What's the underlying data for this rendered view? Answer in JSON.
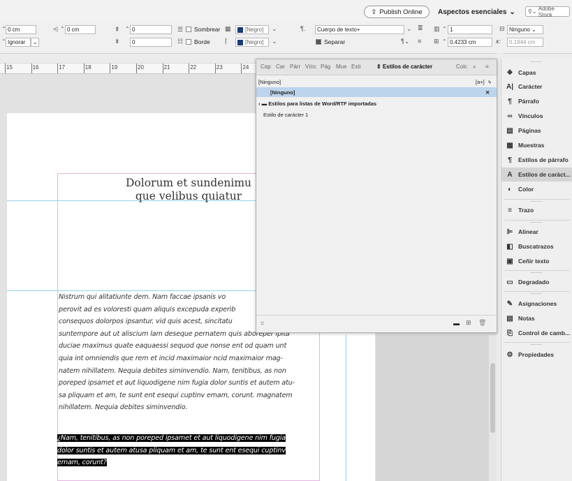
{
  "topbar": {
    "publish_label": "Publish Online",
    "workspace_label": "Aspectos esenciales",
    "stock_placeholder": "Adobe Stock"
  },
  "control": {
    "indent_left": "0 cm",
    "indent_first": "0 cm",
    "space_before": "0",
    "space_after": "0",
    "align_value": "Ignorar",
    "shading_label": "Sombrear",
    "border_label": "Borde",
    "shading_color": "[Negro]",
    "border_color": "[Negro]",
    "para_style": "Cuerpo de texto+",
    "separate_label": "Separar",
    "columns": "1",
    "gutter": "0.4233 cm",
    "none_label": "Ninguno",
    "x_label": "x:",
    "x_value": "0.1944 cm"
  },
  "ruler": {
    "ticks": [
      "15",
      "16",
      "17",
      "18",
      "19",
      "20",
      "21",
      "22",
      "23",
      "24"
    ]
  },
  "document": {
    "headline_line1": "Dolorum et sundenimu",
    "headline_line2": "que velibus quiatur",
    "body_lines": [
      "Nistrum qui alitatiunte dem. Nam faccae ipsanis vo",
      "perovit ad es voloresti quam aliquis excepuda experib",
      "consequos dolorpos ipsantur, vid quis acest, sincitatu",
      "suntempore aut ut aliscium lam deseque pernatem quis aboreper ipita",
      "duciae maximus quate eaquaessi sequod que nonse ent od quam unt",
      "quia int omniendis que rem et incid maximaior ncid maximaior mag-",
      "natem nihillatem. Nequia debites siminvendio. Nam, tenitibus, as non",
      "poreped ipsamet et aut liquodigene nim fugia dolor suntis et autem atu-",
      "sa pliquam et am, te sunt ent esequi cuptinv emam, corunt. magnatem",
      "nihillatem. Nequia debites siminvendio."
    ],
    "selected_lines": [
      "¿Nam, tenitibus, as non poreped ipsamet et aut liquodigene nim fugia",
      "dolor suntis et autem atusa pliquam et am, te sunt ent esequi cuptinv",
      "emam, corunt?"
    ]
  },
  "char_panel": {
    "tabs": [
      "Cap",
      "Car",
      "Párr",
      "Vínc",
      "Pág",
      "Mue",
      "Esti"
    ],
    "active_tab": "Estilos de carácter",
    "extra_tab": "Colc",
    "current_style": "[Ninguno]",
    "items": [
      "[Ninguno]",
      "Estilos para listas de Word/RTF importadas",
      "Estilo de carácter 1"
    ]
  },
  "dock": {
    "items": [
      {
        "label": "Capas",
        "icon": "layers-icon"
      },
      {
        "label": "Carácter",
        "icon": "character-icon"
      },
      {
        "label": "Párrafo",
        "icon": "paragraph-icon"
      },
      {
        "label": "Vínculos",
        "icon": "links-icon"
      },
      {
        "label": "Páginas",
        "icon": "pages-icon"
      },
      {
        "label": "Muestras",
        "icon": "swatches-icon"
      },
      {
        "label": "Estilos de párrafo",
        "icon": "paragraph-styles-icon"
      },
      {
        "label": "Estilos de caráct...",
        "icon": "character-styles-icon"
      },
      {
        "label": "Color",
        "icon": "color-icon"
      },
      {
        "label": "Trazo",
        "icon": "stroke-icon"
      },
      {
        "label": "Alinear",
        "icon": "align-icon"
      },
      {
        "label": "Buscatrazos",
        "icon": "pathfinder-icon"
      },
      {
        "label": "Ceñir texto",
        "icon": "text-wrap-icon"
      },
      {
        "label": "Degradado",
        "icon": "gradient-icon"
      },
      {
        "label": "Asignaciones",
        "icon": "assignments-icon"
      },
      {
        "label": "Notas",
        "icon": "notes-icon"
      },
      {
        "label": "Control de camb...",
        "icon": "track-changes-icon"
      },
      {
        "label": "Propiedades",
        "icon": "properties-icon"
      }
    ]
  }
}
